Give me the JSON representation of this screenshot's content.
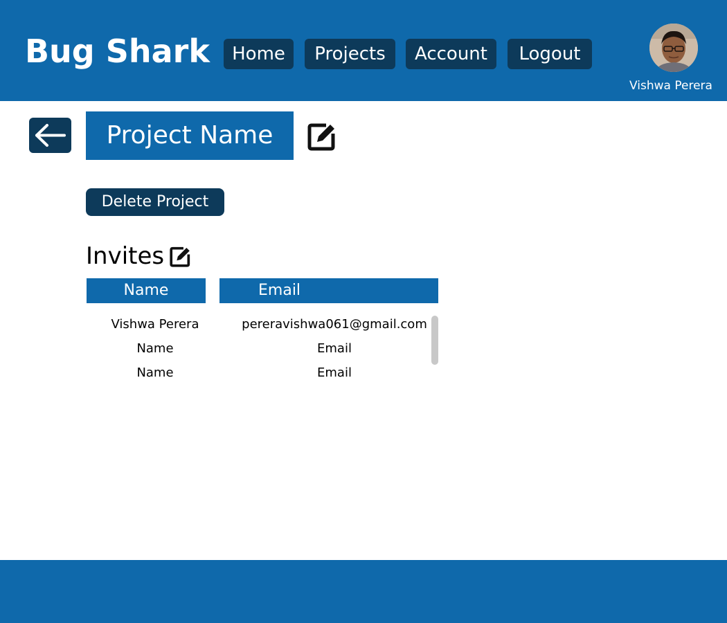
{
  "header": {
    "brand": "Bug Shark",
    "nav": {
      "home": "Home",
      "projects": "Projects",
      "account": "Account",
      "logout": "Logout"
    },
    "user_name": "Vishwa Perera"
  },
  "project": {
    "title": "Project Name",
    "delete_label": "Delete Project"
  },
  "invites": {
    "title": "Invites",
    "columns": {
      "name": "Name",
      "email": "Email"
    },
    "rows": [
      {
        "name": "Vishwa Perera",
        "email": "pereravishwa061@gmail.com"
      },
      {
        "name": "Name",
        "email": "Email"
      },
      {
        "name": "Name",
        "email": "Email"
      }
    ]
  },
  "colors": {
    "primary": "#0f69ab",
    "dark": "#0d3a5a",
    "scrollbar": "#c8c8c8"
  },
  "icons": {
    "back": "arrow-left-icon",
    "edit": "edit-icon",
    "avatar": "user-avatar"
  }
}
